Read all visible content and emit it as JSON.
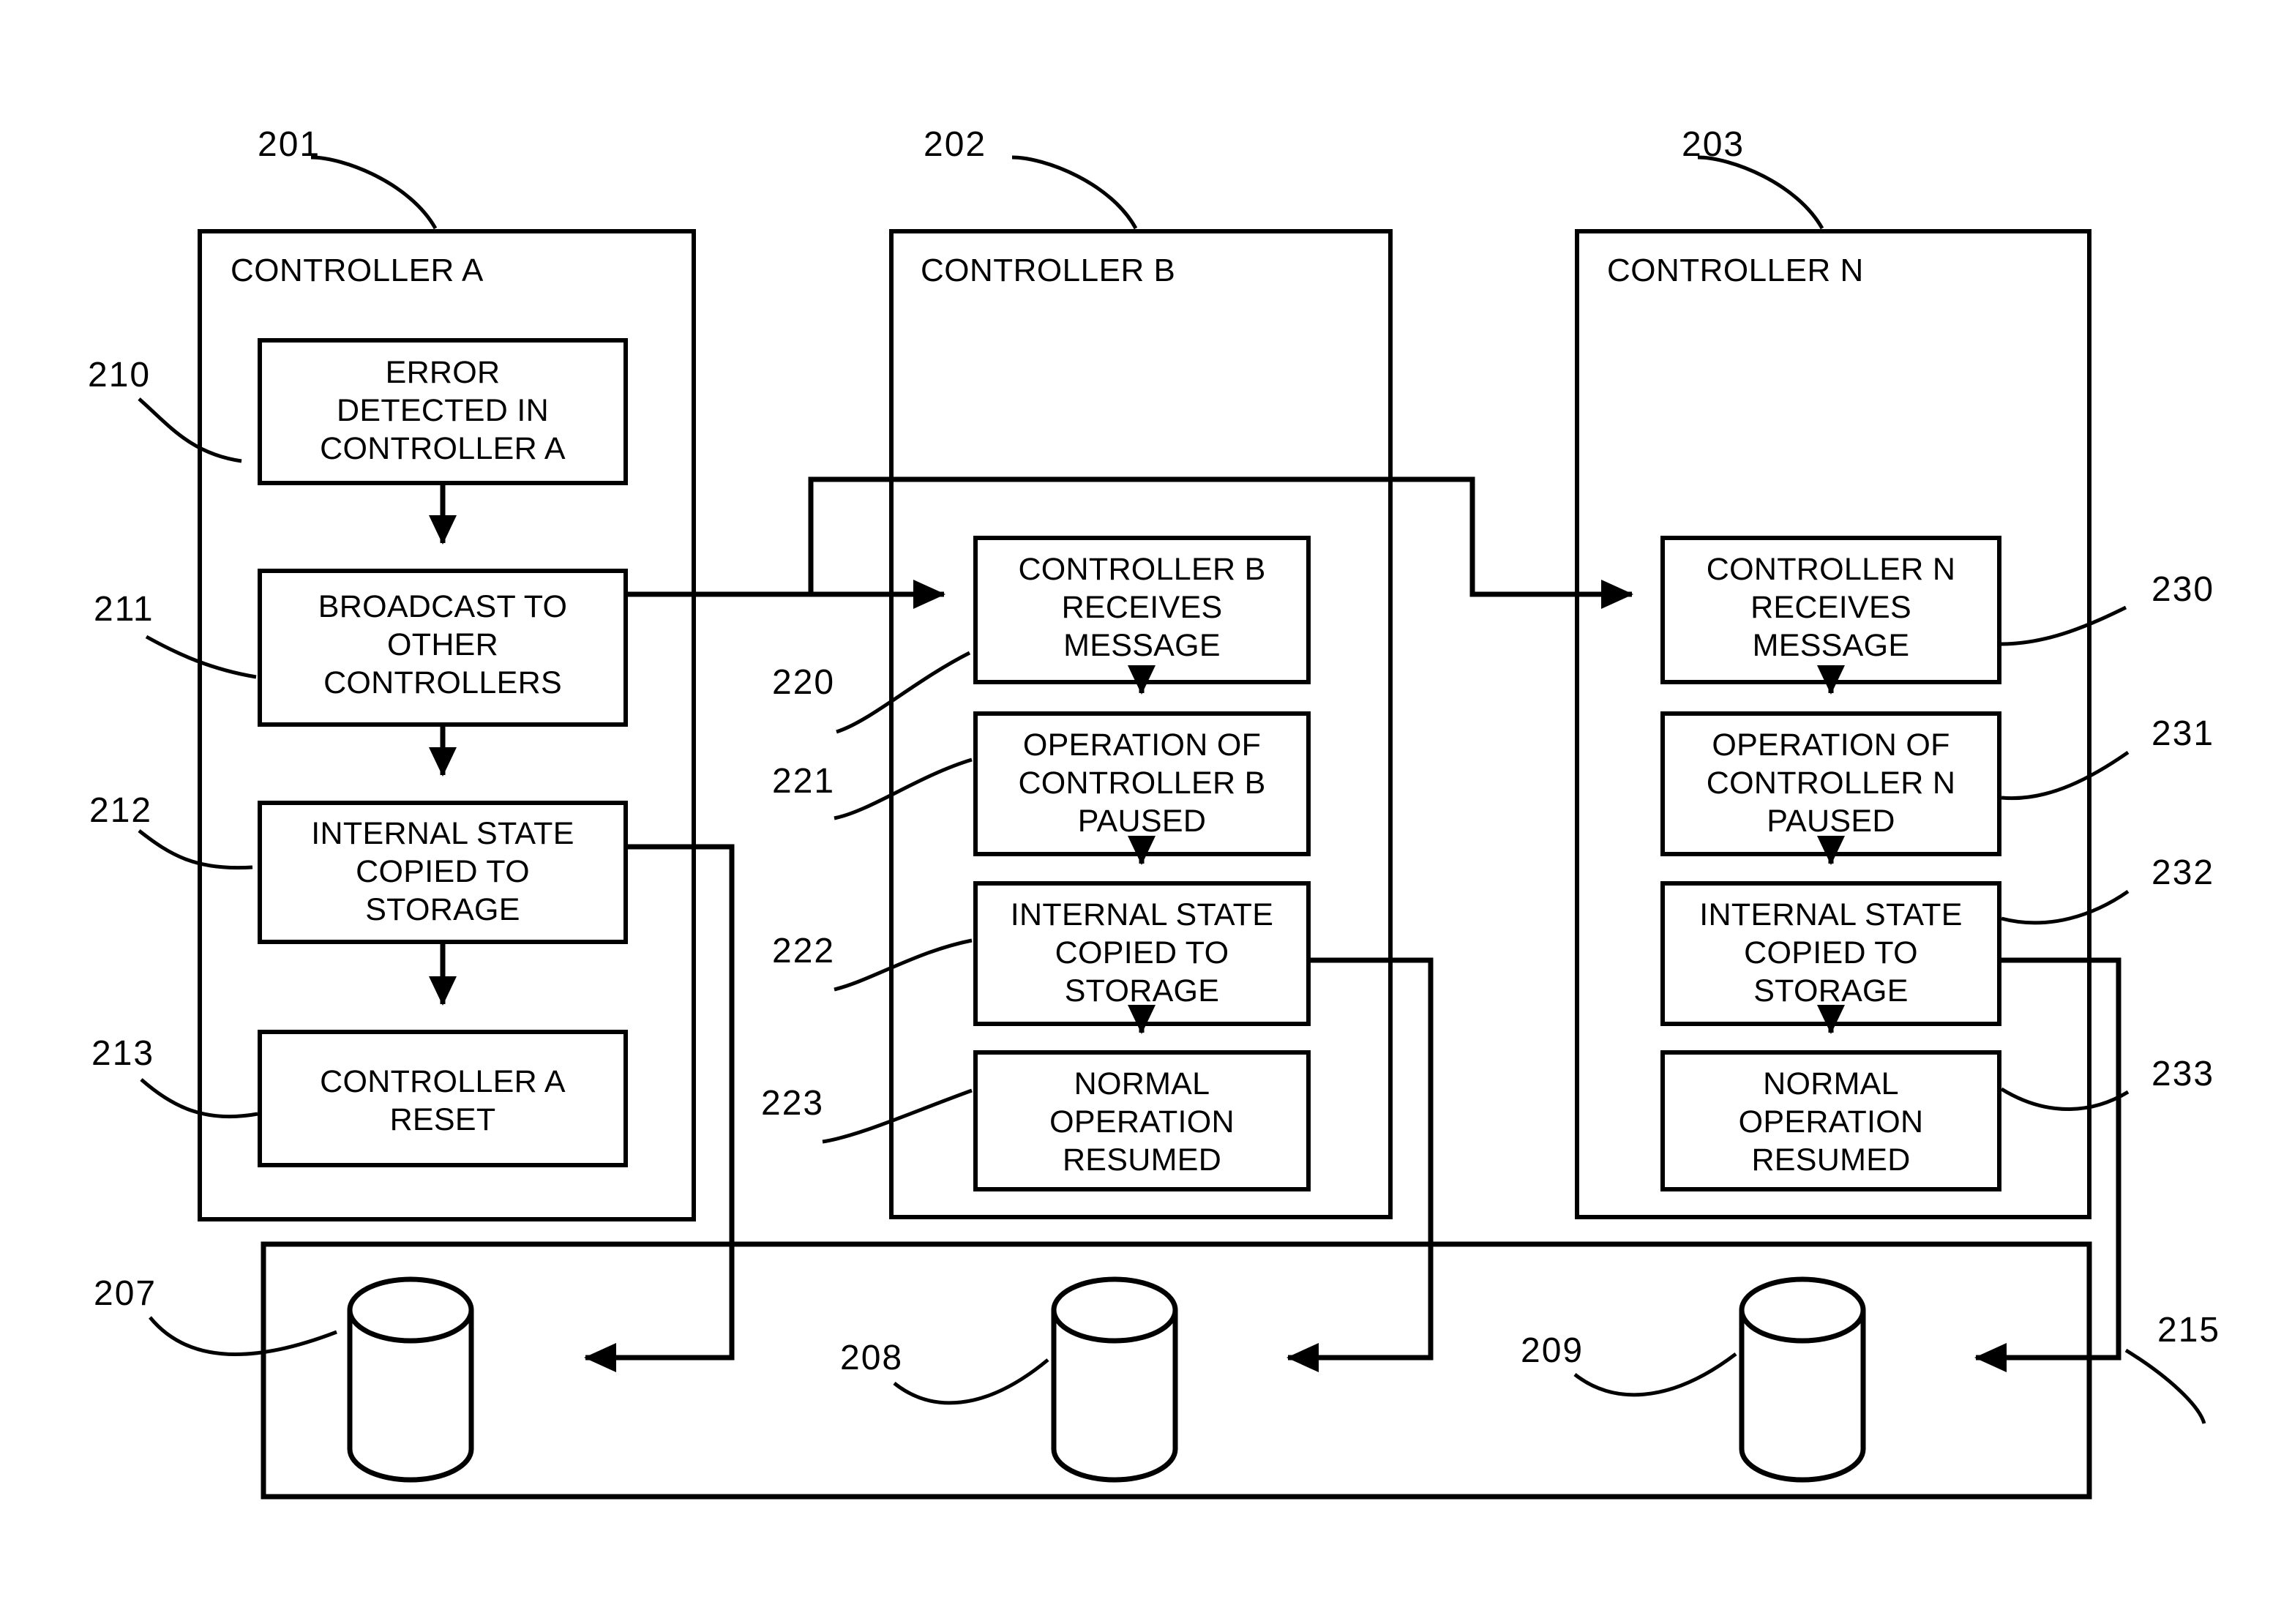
{
  "figure": {
    "kind": "patent-flow-diagram",
    "background": "#ffffff",
    "ink": "#000000"
  },
  "controllers": [
    {
      "ref": "201",
      "title": "CONTROLLER A",
      "steps": [
        {
          "ref": "210",
          "text": "ERROR\nDETECTED IN\nCONTROLLER A"
        },
        {
          "ref": "211",
          "text": "BROADCAST TO\nOTHER\nCONTROLLERS"
        },
        {
          "ref": "212",
          "text": "INTERNAL STATE\nCOPIED TO\nSTORAGE"
        },
        {
          "ref": "213",
          "text": "CONTROLLER A\nRESET"
        }
      ]
    },
    {
      "ref": "202",
      "title": "CONTROLLER B",
      "steps": [
        {
          "ref": "220",
          "text": "CONTROLLER B\nRECEIVES\nMESSAGE"
        },
        {
          "ref": "221",
          "text": "OPERATION OF\nCONTROLLER B\nPAUSED"
        },
        {
          "ref": "222",
          "text": "INTERNAL STATE\nCOPIED TO\nSTORAGE"
        },
        {
          "ref": "223",
          "text": "NORMAL\nOPERATION\nRESUMED"
        }
      ]
    },
    {
      "ref": "203",
      "title": "CONTROLLER N",
      "steps": [
        {
          "ref": "230",
          "text": "CONTROLLER N\nRECEIVES\nMESSAGE"
        },
        {
          "ref": "231",
          "text": "OPERATION OF\nCONTROLLER N\nPAUSED"
        },
        {
          "ref": "232",
          "text": "INTERNAL STATE\nCOPIED TO\nSTORAGE"
        },
        {
          "ref": "233",
          "text": "NORMAL\nOPERATION\nRESUMED"
        }
      ]
    }
  ],
  "storage": {
    "ref": "215",
    "disks": [
      {
        "ref": "207"
      },
      {
        "ref": "208"
      },
      {
        "ref": "209"
      }
    ]
  },
  "ref_labels": {
    "r201": "201",
    "r202": "202",
    "r203": "203",
    "r210": "210",
    "r211": "211",
    "r212": "212",
    "r213": "213",
    "r220": "220",
    "r221": "221",
    "r222": "222",
    "r223": "223",
    "r230": "230",
    "r231": "231",
    "r232": "232",
    "r233": "233",
    "r207": "207",
    "r208": "208",
    "r209": "209",
    "r215": "215"
  },
  "titles": {
    "a": "CONTROLLER A",
    "b": "CONTROLLER B",
    "n": "CONTROLLER N"
  },
  "step_text": {
    "s210_l1": "ERROR",
    "s210_l2": "DETECTED IN",
    "s210_l3": "CONTROLLER A",
    "s211_l1": "BROADCAST TO",
    "s211_l2": "OTHER",
    "s211_l3": "CONTROLLERS",
    "s212_l1": "INTERNAL STATE",
    "s212_l2": "COPIED TO",
    "s212_l3": "STORAGE",
    "s213_l1": "CONTROLLER A",
    "s213_l2": "RESET",
    "s220_l1": "CONTROLLER B",
    "s220_l2": "RECEIVES",
    "s220_l3": "MESSAGE",
    "s221_l1": "OPERATION OF",
    "s221_l2": "CONTROLLER B",
    "s221_l3": "PAUSED",
    "s222_l1": "INTERNAL STATE",
    "s222_l2": "COPIED TO",
    "s222_l3": "STORAGE",
    "s223_l1": "NORMAL",
    "s223_l2": "OPERATION",
    "s223_l3": "RESUMED",
    "s230_l1": "CONTROLLER N",
    "s230_l2": "RECEIVES",
    "s230_l3": "MESSAGE",
    "s231_l1": "OPERATION OF",
    "s231_l2": "CONTROLLER N",
    "s231_l3": "PAUSED",
    "s232_l1": "INTERNAL STATE",
    "s232_l2": "COPIED TO",
    "s232_l3": "STORAGE",
    "s233_l1": "NORMAL",
    "s233_l2": "OPERATION",
    "s233_l3": "RESUMED"
  }
}
